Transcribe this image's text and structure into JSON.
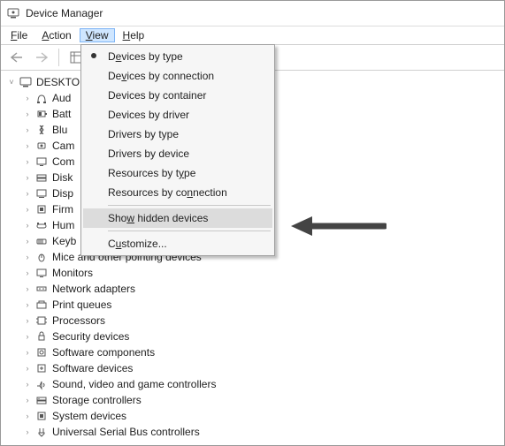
{
  "title": "Device Manager",
  "menubar": {
    "file": "File",
    "file_ul": "F",
    "action": "Action",
    "action_ul": "A",
    "view": "View",
    "view_ul": "V",
    "help": "Help",
    "help_ul": "H"
  },
  "view_menu": {
    "by_type": "Devices by type",
    "by_conn": "Devices by connection",
    "by_cont": "Devices by container",
    "by_drv": "Devices by driver",
    "d_type": "Drivers by type",
    "d_dev": "Drivers by device",
    "r_type": "Resources by type",
    "r_conn": "Resources by connection",
    "show_hidden": "Show hidden devices",
    "customize": "Customize..."
  },
  "tree": {
    "root": "DESKTO",
    "items": [
      "Aud",
      "Batt",
      "Blu",
      "Cam",
      "Com",
      "Disk",
      "Disp",
      "Firm",
      "Hum",
      "Keyb",
      "Mice and other pointing devices",
      "Monitors",
      "Network adapters",
      "Print queues",
      "Processors",
      "Security devices",
      "Software components",
      "Software devices",
      "Sound, video and game controllers",
      "Storage controllers",
      "System devices",
      "Universal Serial Bus controllers"
    ]
  }
}
